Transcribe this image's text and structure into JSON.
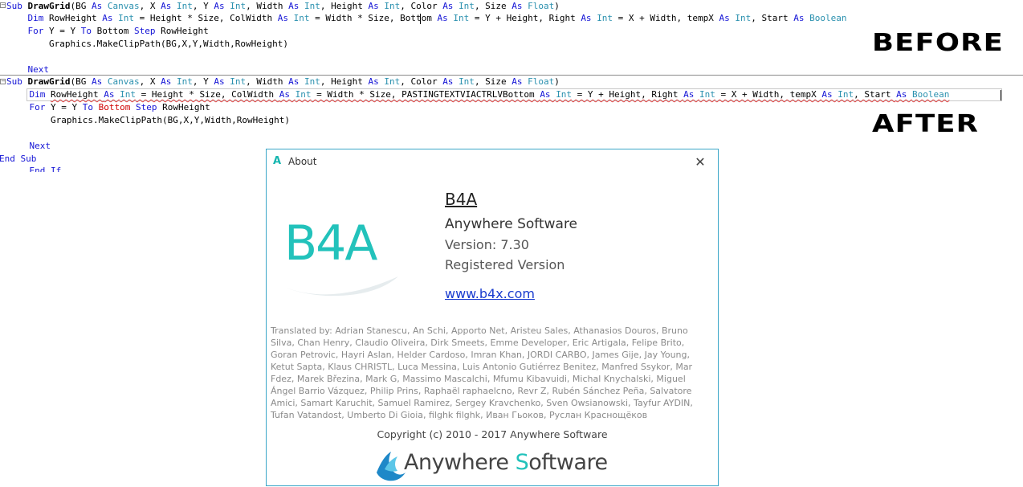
{
  "editor": {
    "before_label": "BEFORE",
    "after_label": "AFTER",
    "before": {
      "line1": {
        "p": [
          {
            "t": "Sub ",
            "c": "kw"
          },
          {
            "t": "DrawGrid",
            "c": "bold"
          },
          {
            "t": "(BG ",
            "c": ""
          },
          {
            "t": "As ",
            "c": "kw"
          },
          {
            "t": "Canvas",
            "c": "tp"
          },
          {
            "t": ", X ",
            "c": ""
          },
          {
            "t": "As ",
            "c": "kw"
          },
          {
            "t": "Int",
            "c": "tp"
          },
          {
            "t": ", Y ",
            "c": ""
          },
          {
            "t": "As ",
            "c": "kw"
          },
          {
            "t": "Int",
            "c": "tp"
          },
          {
            "t": ", Width ",
            "c": ""
          },
          {
            "t": "As ",
            "c": "kw"
          },
          {
            "t": "Int",
            "c": "tp"
          },
          {
            "t": ", Height ",
            "c": ""
          },
          {
            "t": "As ",
            "c": "kw"
          },
          {
            "t": "Int",
            "c": "tp"
          },
          {
            "t": ", Color ",
            "c": ""
          },
          {
            "t": "As ",
            "c": "kw"
          },
          {
            "t": "Int",
            "c": "tp"
          },
          {
            "t": ", Size ",
            "c": ""
          },
          {
            "t": "As ",
            "c": "kw"
          },
          {
            "t": "Float",
            "c": "tp"
          },
          {
            "t": ")",
            "c": ""
          }
        ]
      },
      "line2": {
        "p": [
          {
            "t": "    Dim ",
            "c": "kw"
          },
          {
            "t": "RowHeight ",
            "c": ""
          },
          {
            "t": "As ",
            "c": "kw"
          },
          {
            "t": "Int",
            "c": "tp"
          },
          {
            "t": " = Height * Size, ColWidth ",
            "c": ""
          },
          {
            "t": "As ",
            "c": "kw"
          },
          {
            "t": "Int",
            "c": "tp"
          },
          {
            "t": " = Width * Size, Bottom ",
            "c": ""
          },
          {
            "t": "As ",
            "c": "kw"
          },
          {
            "t": "Int",
            "c": "tp"
          },
          {
            "t": " = Y + Height, Right ",
            "c": ""
          },
          {
            "t": "As ",
            "c": "kw"
          },
          {
            "t": "Int",
            "c": "tp"
          },
          {
            "t": " = X + Width, tempX ",
            "c": ""
          },
          {
            "t": "As ",
            "c": "kw"
          },
          {
            "t": "Int",
            "c": "tp"
          },
          {
            "t": ", Start ",
            "c": ""
          },
          {
            "t": "As ",
            "c": "kw"
          },
          {
            "t": "Boolean",
            "c": "tp"
          }
        ]
      },
      "line3": {
        "p": [
          {
            "t": "    For ",
            "c": "kw"
          },
          {
            "t": "Y = Y ",
            "c": ""
          },
          {
            "t": "To ",
            "c": "kw"
          },
          {
            "t": "Bottom ",
            "c": ""
          },
          {
            "t": "Step ",
            "c": "kw"
          },
          {
            "t": "RowHeight",
            "c": ""
          }
        ]
      },
      "line4": {
        "p": [
          {
            "t": "        Graphics.MakeClipPath(BG,X,Y,Width,RowHeight)",
            "c": ""
          }
        ]
      },
      "line5": {
        "p": [
          {
            "t": "    Next",
            "c": "kw"
          }
        ]
      }
    },
    "after": {
      "line1": {
        "p": [
          {
            "t": "Sub ",
            "c": "kw"
          },
          {
            "t": "DrawGrid",
            "c": "bold"
          },
          {
            "t": "(BG ",
            "c": ""
          },
          {
            "t": "As ",
            "c": "kw"
          },
          {
            "t": "Canvas",
            "c": "tp"
          },
          {
            "t": ", X ",
            "c": ""
          },
          {
            "t": "As ",
            "c": "kw"
          },
          {
            "t": "Int",
            "c": "tp"
          },
          {
            "t": ", Y ",
            "c": ""
          },
          {
            "t": "As ",
            "c": "kw"
          },
          {
            "t": "Int",
            "c": "tp"
          },
          {
            "t": ", Width ",
            "c": ""
          },
          {
            "t": "As ",
            "c": "kw"
          },
          {
            "t": "Int",
            "c": "tp"
          },
          {
            "t": ", Height ",
            "c": ""
          },
          {
            "t": "As ",
            "c": "kw"
          },
          {
            "t": "Int",
            "c": "tp"
          },
          {
            "t": ", Color ",
            "c": ""
          },
          {
            "t": "As ",
            "c": "kw"
          },
          {
            "t": "Int",
            "c": "tp"
          },
          {
            "t": ", Size ",
            "c": ""
          },
          {
            "t": "As ",
            "c": "kw"
          },
          {
            "t": "Float",
            "c": "tp"
          },
          {
            "t": ")",
            "c": ""
          }
        ]
      },
      "line2": {
        "p": [
          {
            "t": "    Dim ",
            "c": "kw"
          },
          {
            "t": "RowHeight ",
            "c": "squig"
          },
          {
            "t": "As ",
            "c": "kw squig"
          },
          {
            "t": "Int",
            "c": "tp squig"
          },
          {
            "t": " = Height * Size, ColWidth ",
            "c": "squig"
          },
          {
            "t": "As ",
            "c": "kw squig"
          },
          {
            "t": "Int",
            "c": "tp squig"
          },
          {
            "t": " = Width * Size, PASTINGTEXTVIACTRLVBottom ",
            "c": "squig"
          },
          {
            "t": "As ",
            "c": "kw squig"
          },
          {
            "t": "Int",
            "c": "tp squig"
          },
          {
            "t": " = Y + Height, Right ",
            "c": "squig"
          },
          {
            "t": "As ",
            "c": "kw squig"
          },
          {
            "t": "Int",
            "c": "tp squig"
          },
          {
            "t": " = X + Width, tempX ",
            "c": "squig"
          },
          {
            "t": "As ",
            "c": "kw squig"
          },
          {
            "t": "Int",
            "c": "tp squig"
          },
          {
            "t": ", Start ",
            "c": "squig"
          },
          {
            "t": "As ",
            "c": "kw squig"
          },
          {
            "t": "Boolean",
            "c": "tp squig"
          }
        ]
      },
      "line3": {
        "p": [
          {
            "t": "    For ",
            "c": "kw"
          },
          {
            "t": "Y = Y ",
            "c": ""
          },
          {
            "t": "To ",
            "c": "kw"
          },
          {
            "t": "Bottom ",
            "c": "red"
          },
          {
            "t": "Step ",
            "c": "kw"
          },
          {
            "t": "RowHeight",
            "c": ""
          }
        ]
      },
      "line4": {
        "p": [
          {
            "t": "        Graphics.MakeClipPath(BG,X,Y,Width,RowHeight)",
            "c": ""
          }
        ]
      },
      "line5": {
        "p": [
          {
            "t": "    Next",
            "c": "kw"
          }
        ]
      },
      "line6": {
        "p": [
          {
            "t": "End Sub",
            "c": "kw"
          }
        ]
      },
      "line7": {
        "p": [
          {
            "t": "    End If",
            "c": "kw"
          }
        ]
      }
    }
  },
  "about_dialog": {
    "title_icon": "A",
    "title": "About",
    "close_glyph": "✕",
    "logo_text": "B4A",
    "app_name": "B4A",
    "company": "Anywhere Software",
    "version": "Version: 7.30",
    "registration": "Registered Version",
    "website": "www.b4x.com",
    "credits": "Translated by: Adrian Stanescu, An Schi, Apporto Net, Aristeu Sales, Athanasios Douros, Bruno Silva, Chan Henry, Claudio Oliveira, Dirk Smeets, Emme Developer, Eric Artigala, Felipe Brito, Goran Petrovic, Hayri Aslan, Helder Cardoso, Imran Khan, JORDI CARBO, James Gije, Jay Young, Ketut Sapta, Klaus CHRISTL, Luca Messina, Luis Antonio Gutiérrez Benitez, Manfred Ssykor, Mar Fdez, Marek Březina, Mark G, Massimo Mascalchi, Mfumu Kibavuidi, Michal Knychalski, Miguel Ángel Barrio Vázquez, Philip Prins, Raphaël raphaelcno, Revr Z, Rubén Sánchez Peña, Salvatore Amici, Samart Karuchit, Samuel Ramirez, Sergey Kravchenko, Sven Owsianowski, Tayfur AYDIN, Tufan Vatandost, Umberto Di Gioia, filghk filghk, Иван Гьоков, Руслан Краснощёков",
    "copyright": "Copyright (c) 2010 - 2017 Anywhere Software",
    "footer_logo_a": "Anywhere ",
    "footer_logo_s": "S",
    "footer_logo_rest": "oftware"
  },
  "colors": {
    "keyword": "#1414d6",
    "type": "#2b91af",
    "error": "#d00000",
    "brand_teal": "#22c2bb",
    "dialog_border": "#3aa6c8",
    "link": "#1a3ccf"
  }
}
